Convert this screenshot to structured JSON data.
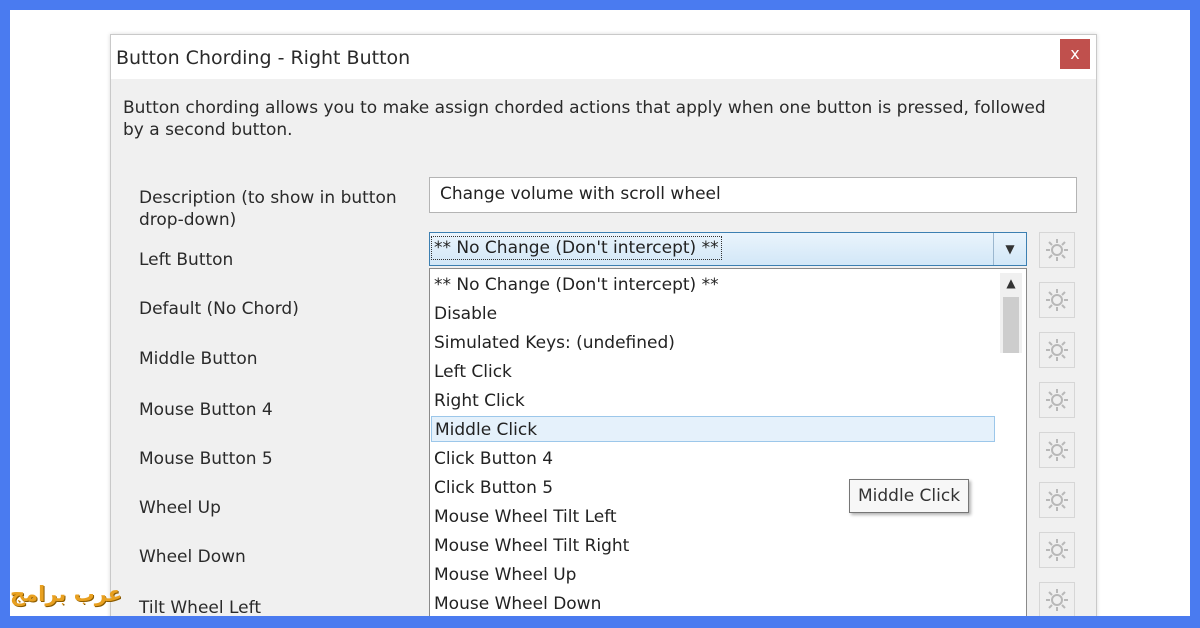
{
  "window": {
    "title": "Button Chording - Right Button",
    "close_glyph": "x"
  },
  "intro": "Button chording allows you to make assign chorded actions that apply when one button is pressed, followed by a second button.",
  "form": {
    "description_label_line1": "Description (to show in button",
    "description_label_line2": "drop-down)",
    "description_value": "Change volume with scroll wheel",
    "rows": [
      {
        "label": "Left Button"
      },
      {
        "label": "Default (No Chord)"
      },
      {
        "label": "Middle Button"
      },
      {
        "label": "Mouse Button 4"
      },
      {
        "label": "Mouse Button 5"
      },
      {
        "label": "Wheel Up"
      },
      {
        "label": "Wheel Down"
      },
      {
        "label": "Tilt Wheel Left"
      }
    ],
    "selected_value": "** No Change (Don't intercept) **"
  },
  "dropdown": {
    "options": [
      "** No Change (Don't intercept) **",
      "Disable",
      "Simulated Keys: (undefined)",
      "Left Click",
      "Right Click",
      "Middle Click",
      "Click Button 4",
      "Click Button 5",
      "Mouse Wheel Tilt Left",
      "Mouse Wheel Tilt Right",
      "Mouse Wheel Up",
      "Mouse Wheel Down"
    ],
    "highlighted": "Middle Click"
  },
  "tooltip": "Middle Click",
  "watermark": "عرب برامج",
  "icons": {
    "close": "close-icon",
    "dropdown_arrow": "chevron-down-icon",
    "scroll_up": "chevron-up-icon",
    "settings": "gear-icon"
  },
  "colors": {
    "background": "#4a7bf0",
    "close_button": "#c0504d",
    "highlight": "#e5f1fb",
    "watermark": "#e8a020"
  }
}
